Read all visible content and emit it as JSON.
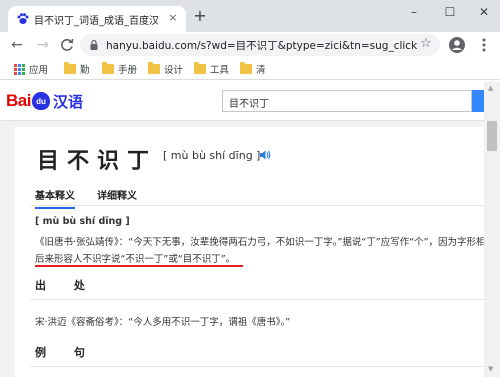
{
  "browser": {
    "tab_title": "目不识丁_词语_成语_百度汉语",
    "tab_close": "×",
    "new_tab": "+",
    "window_controls": [
      "–",
      "☐",
      "✕"
    ],
    "url": "hanyu.baidu.com/s?wd=目不识丁&ptype=zici&tn=sug_click",
    "star": "☆",
    "nav": {
      "back": "←",
      "forward": "→",
      "reload": "C"
    },
    "bookmarks": [
      "应用",
      "勤",
      "手册",
      "设计",
      "工具",
      "清"
    ],
    "accent": "#1a73e8"
  },
  "site": {
    "logo_bai": "Bai",
    "logo_du": "du",
    "logo_han": "汉语",
    "search_value": "目不识丁",
    "brand_red": "#e10601",
    "brand_blue": "#2932e1"
  },
  "entry": {
    "word": "目不识丁",
    "pinyin": "[ mù bù shí dīng ]",
    "tabs": [
      "基本释义",
      "详细释义"
    ],
    "def_pinyin": "[ mù bù shí dīng ]",
    "def_lines": [
      "《旧唐书·张弘靖传》：“今天下无事，汝辈挽得两石力弓，不如识一丁字。”据说“丁”应写作“个”，因为字形相近",
      "后来形容人不识字说“不识一丁”或“目不识丁”。"
    ],
    "section_source": "出 处",
    "source_text": "宋·洪迈《容斋俗考》：“今人多用不识一丁字，谓祖《唐书》。”",
    "section_example": "例 句"
  }
}
